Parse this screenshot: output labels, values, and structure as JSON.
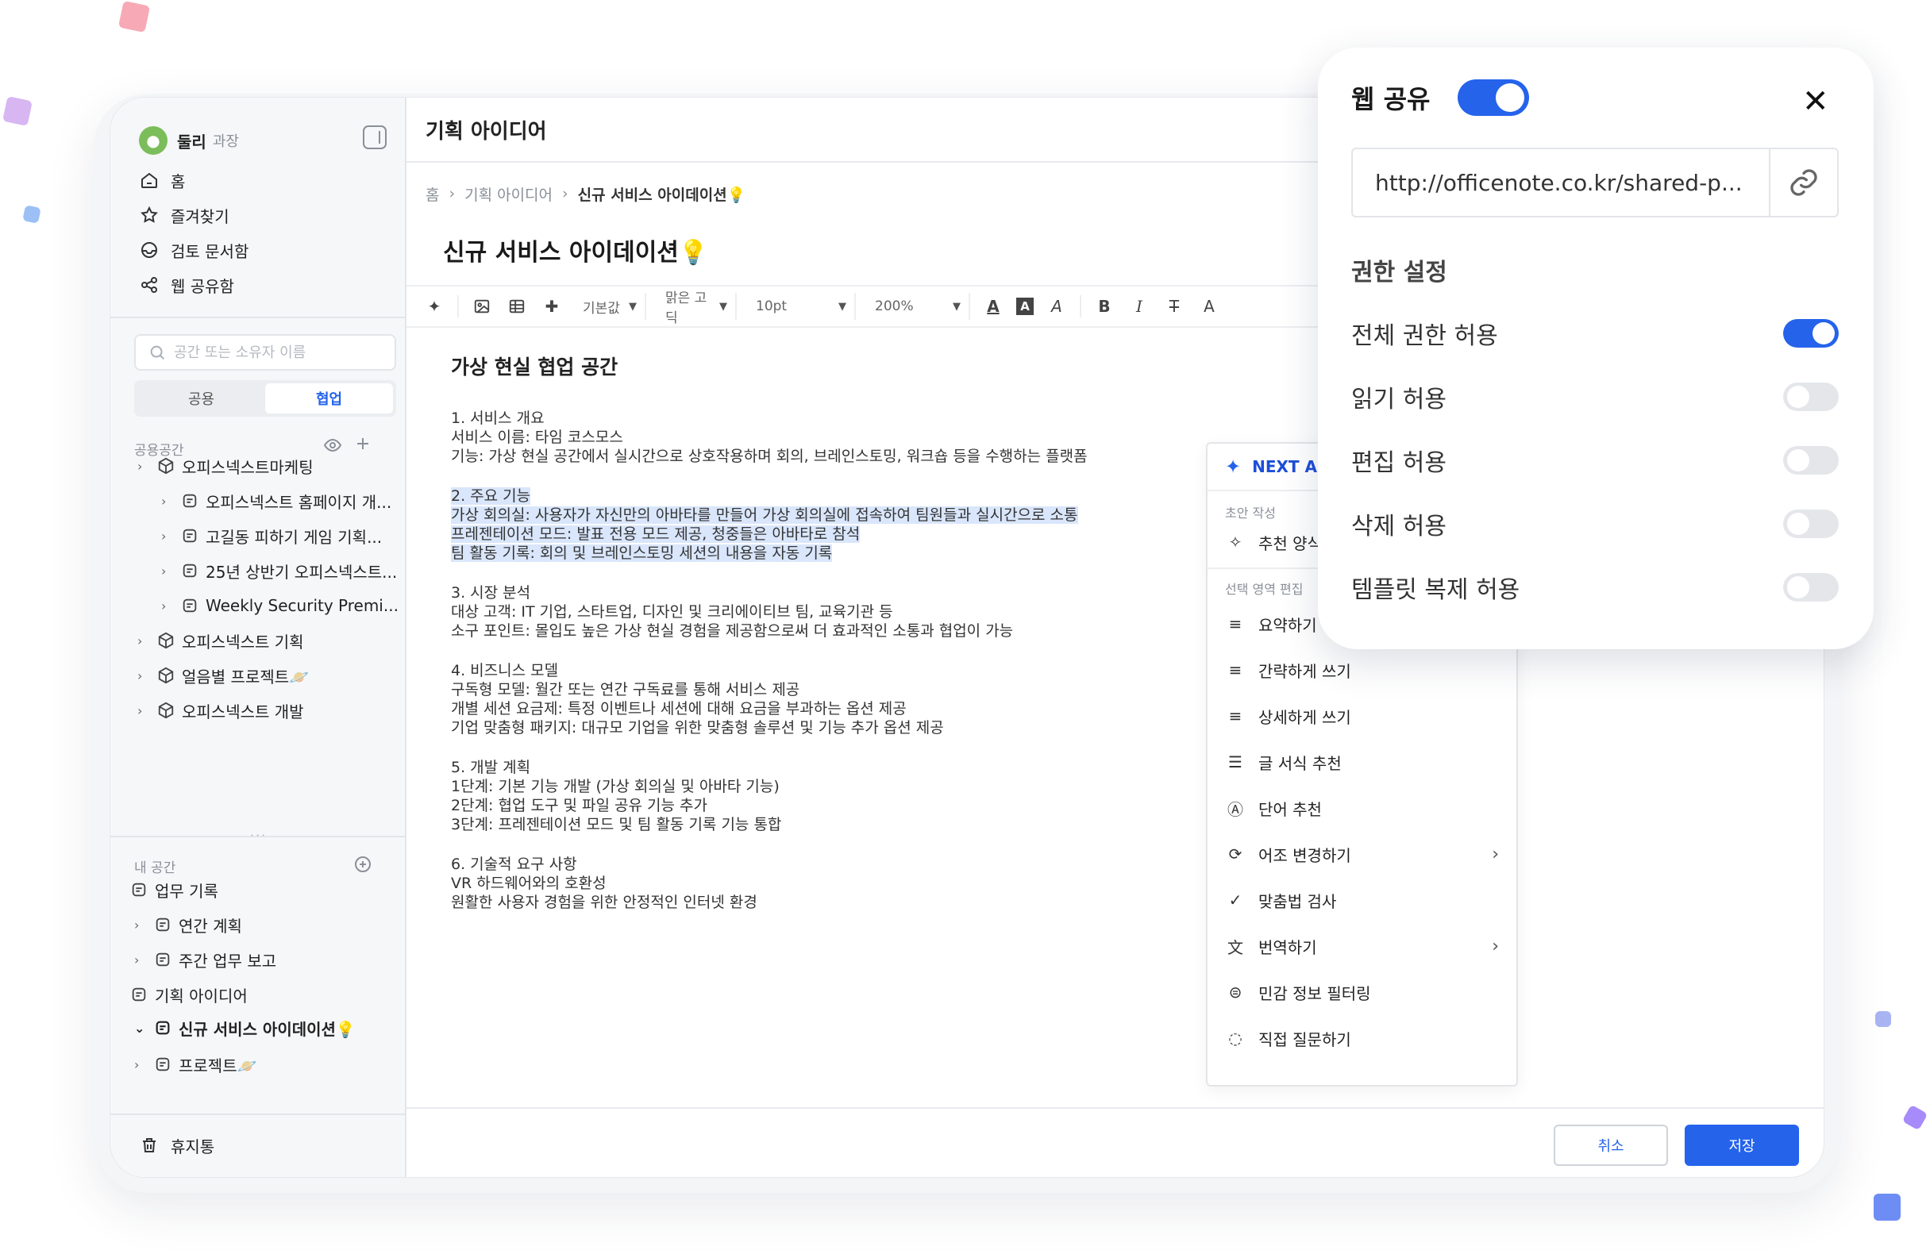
{
  "sidebar": {
    "user_name": "둘리",
    "user_rank": "과장",
    "nav": [
      {
        "label": "홈",
        "icon": "home-icon"
      },
      {
        "label": "즐겨찾기",
        "icon": "star-icon"
      },
      {
        "label": "검토 문서함",
        "icon": "inbox-icon"
      },
      {
        "label": "웹 공유함",
        "icon": "share-icon"
      }
    ],
    "search_placeholder": "공간 또는 소유자 이름",
    "tabs": [
      "공용",
      "협업"
    ],
    "shared_label": "공용공간",
    "shared_tree": [
      {
        "label": "오피스넥스트마케팅",
        "level": 0
      },
      {
        "label": "오피스넥스트 홈페이지 개...",
        "level": 1
      },
      {
        "label": "고길동 피하기 게임 기획...",
        "level": 1
      },
      {
        "label": "25년 상반기 오피스넥스트...",
        "level": 1
      },
      {
        "label": "Weekly Security Premi...",
        "level": 1
      },
      {
        "label": "오피스넥스트 기획",
        "level": 0
      },
      {
        "label": "얼음별 프로젝트🪐",
        "level": 0
      },
      {
        "label": "오피스넥스트 개발",
        "level": 0
      }
    ],
    "my_label": "내 공간",
    "my_tree": [
      {
        "label": "업무 기록"
      },
      {
        "label": "연간 계획"
      },
      {
        "label": "주간 업무 보고"
      },
      {
        "label": "기획 아이디어"
      },
      {
        "label": "신규 서비스 아이데이션💡"
      },
      {
        "label": "프로젝트🪐"
      }
    ],
    "trash": "휴지통"
  },
  "main": {
    "header_title": "기획 아이디어",
    "breadcrumb": [
      "홈",
      "기획 아이디어",
      "신규 서비스 아이데이션💡"
    ],
    "doc_title": "신규 서비스 아이데이션💡",
    "toolbar": {
      "style": "기본값",
      "font": "맑은 고딕",
      "size": "10pt",
      "zoom": "200%"
    },
    "heading": "가상 현실 협업 공간",
    "lines": [
      "1. 서비스 개요",
      "서비스 이름: 타임 코스모스",
      "기능: 가상 현실 공간에서 실시간으로 상호작용하며 회의, 브레인스토밍, 워크숍 등을 수행하는 플랫폼"
    ],
    "highlight_lines": [
      "2. 주요 기능",
      "가상 회의실: 사용자가 자신만의 아바타를 만들어 가상 회의실에 접속하여 팀원들과 실시간으로 소통",
      "프레젠테이션 모드: 발표 전용 모드 제공, 청중들은 아바타로 참석",
      "팀 활동 기록: 회의 및 브레인스토밍 세션의 내용을 자동 기록"
    ],
    "sec3": [
      "3. 시장 분석",
      "대상 고객: IT 기업, 스타트업, 디자인 및 크리에이티브 팀, 교육기관 등",
      "소구 포인트: 몰입도 높은 가상 현실 경험을 제공함으로써 더 효과적인 소통과 협업이 가능"
    ],
    "sec4": [
      "4. 비즈니스 모델",
      "구독형 모델: 월간 또는 연간 구독료를 통해 서비스 제공",
      "개별 세션 요금제: 특정 이벤트나 세션에 대해 요금을 부과하는 옵션 제공",
      "기업 맞춤형 패키지: 대규모 기업을 위한 맞춤형 솔루션 및 기능 추가 옵션 제공"
    ],
    "sec5": [
      "5. 개발 계획",
      "1단계: 기본 기능 개발 (가상 회의실 및 아바타 기능)",
      "2단계: 협업 도구 및 파일 공유 기능 추가",
      "3단계: 프레젠테이션 모드 및 팀 활동 기록 기능 통합"
    ],
    "sec6": [
      "6. 기술적 요구 사항",
      "VR 하드웨어와의 호환성",
      "원활한 사용자 경험을 위한 안정적인 인터넷 환경"
    ],
    "cancel": "취소",
    "save": "저장"
  },
  "ai_menu": {
    "title": "NEXT AI",
    "draft_label": "초안 작성",
    "draft_item": "추천 양식으로 만들기",
    "edit_label": "선택 영역 편집",
    "items": [
      "요약하기",
      "간략하게 쓰기",
      "상세하게 쓰기",
      "글 서식 추천",
      "단어 추천",
      "어조 변경하기",
      "맞춤법 검사",
      "번역하기",
      "민감 정보 필터링",
      "직접 질문하기"
    ]
  },
  "share": {
    "title": "웹 공유",
    "enabled": true,
    "url": "http://officenote.co.kr/shared-p...",
    "perm_title": "권한 설정",
    "permissions": [
      {
        "label": "전체 권한 허용",
        "on": true
      },
      {
        "label": "읽기 허용",
        "on": false
      },
      {
        "label": "편집 허용",
        "on": false
      },
      {
        "label": "삭제 허용",
        "on": false
      },
      {
        "label": "템플릿 복제 허용",
        "on": false
      }
    ]
  },
  "colors": {
    "accent": "#2563eb",
    "highlight": "#d9e6fb"
  }
}
